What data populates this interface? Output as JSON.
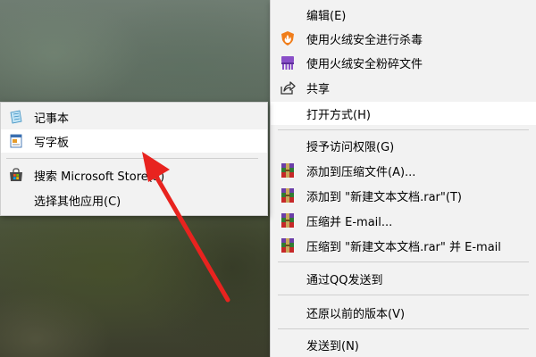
{
  "main_menu": {
    "items": [
      {
        "label": "编辑(E)",
        "icon": ""
      },
      {
        "label": "使用火绒安全进行杀毒",
        "icon": "huorong-shield-icon"
      },
      {
        "label": "使用火绒安全粉碎文件",
        "icon": "file-shredder-icon"
      },
      {
        "label": "共享",
        "icon": "share-icon"
      },
      {
        "label": "打开方式(H)",
        "icon": ""
      },
      {
        "label": "授予访问权限(G)",
        "icon": ""
      },
      {
        "label": "添加到压缩文件(A)...",
        "icon": "winrar-icon"
      },
      {
        "label": "添加到 \"新建文本文档.rar\"(T)",
        "icon": "winrar-icon"
      },
      {
        "label": "压缩并 E-mail...",
        "icon": "winrar-icon"
      },
      {
        "label": "压缩到 \"新建文本文档.rar\" 并 E-mail",
        "icon": "winrar-icon"
      },
      {
        "label": "通过QQ发送到",
        "icon": ""
      },
      {
        "label": "还原以前的版本(V)",
        "icon": ""
      },
      {
        "label": "发送到(N)",
        "icon": ""
      }
    ],
    "highlighted": "打开方式(H)"
  },
  "open_with_submenu": {
    "items": [
      {
        "label": "记事本",
        "icon": "notepad-icon"
      },
      {
        "label": "写字板",
        "icon": "wordpad-icon"
      },
      {
        "label": "搜索 Microsoft Store(S)",
        "icon": "microsoft-store-icon"
      },
      {
        "label": "选择其他应用(C)",
        "icon": ""
      }
    ],
    "highlighted": "写字板"
  },
  "colors": {
    "menu_bg": "#f2f2f2",
    "highlight_bg": "#ffffff",
    "separator": "#cfcfcf",
    "annotation_arrow": "#e8231f",
    "huorong_orange": "#f07d1a",
    "shredder_purple": "#8a4fc8"
  }
}
